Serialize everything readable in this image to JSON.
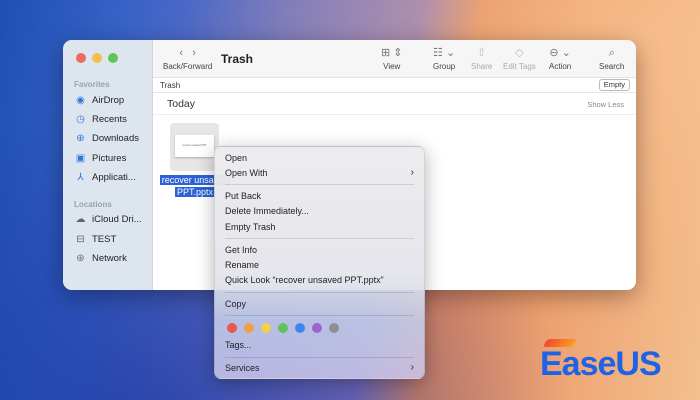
{
  "window": {
    "title": "Trash",
    "traffic_lights": [
      "#ec6a5e",
      "#f4bf4f",
      "#61c554"
    ]
  },
  "sidebar": {
    "favorites_label": "Favorites",
    "favorites": [
      {
        "label": "AirDrop",
        "icon": "airdrop-icon"
      },
      {
        "label": "Recents",
        "icon": "clock-icon"
      },
      {
        "label": "Downloads",
        "icon": "download-icon"
      },
      {
        "label": "Pictures",
        "icon": "pictures-icon"
      },
      {
        "label": "Applicati...",
        "icon": "applications-icon"
      }
    ],
    "locations_label": "Locations",
    "locations": [
      {
        "label": "iCloud Dri...",
        "icon": "cloud-icon"
      },
      {
        "label": "TEST",
        "icon": "drive-icon"
      },
      {
        "label": "Network",
        "icon": "network-icon"
      }
    ]
  },
  "toolbar": {
    "back_forward": "Back/Forward",
    "view": "View",
    "group": "Group",
    "share": "Share",
    "edit_tags": "Edit Tags",
    "action": "Action",
    "search": "Search"
  },
  "pathbar": {
    "label": "Trash",
    "empty_button": "Empty"
  },
  "section": {
    "title": "Today",
    "show_less": "Show Less"
  },
  "file": {
    "name_line1": "recover unsaved",
    "name_line2": "PPT.pptx",
    "thumb_text": "recover unsaved PPT"
  },
  "context_menu": {
    "open": "Open",
    "open_with": "Open With",
    "put_back": "Put Back",
    "delete_immediately": "Delete Immediately...",
    "empty_trash": "Empty Trash",
    "get_info": "Get Info",
    "rename": "Rename",
    "quick_look": "Quick Look “recover unsaved PPT.pptx”",
    "copy": "Copy",
    "tag_colors": [
      "#e8584f",
      "#f0a044",
      "#f3cf4a",
      "#5fc45a",
      "#3f86ea",
      "#a062d0",
      "#8e8e93"
    ],
    "tags": "Tags...",
    "services": "Services"
  },
  "brand": {
    "logo_text": "EaseUS"
  }
}
